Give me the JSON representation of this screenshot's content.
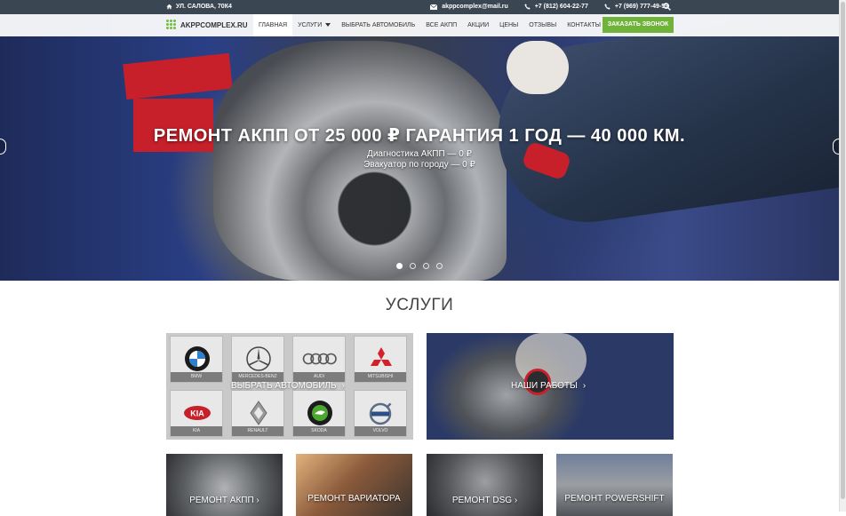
{
  "topbar": {
    "address": "УЛ. САЛОВА, 70К4",
    "email": "akppcomplex@mail.ru",
    "phone1": "+7 (812) 604-22-77",
    "phone2": "+7 (969) 777-49-59"
  },
  "nav": {
    "logo": "AKPPCOMPLEX.RU",
    "items": [
      {
        "label": "ГЛАВНАЯ"
      },
      {
        "label": "УСЛУГИ"
      },
      {
        "label": "ВЫБРАТЬ АВТОМОБИЛЬ"
      },
      {
        "label": "ВСЕ АКПП"
      },
      {
        "label": "АКЦИИ"
      },
      {
        "label": "ЦЕНЫ"
      },
      {
        "label": "ОТЗЫВЫ"
      },
      {
        "label": "КОНТАКТЫ"
      }
    ],
    "call_button": "ЗАКАЗАТЬ ЗВОНОК"
  },
  "hero": {
    "title": "РЕМОНТ АКПП ОТ 25 000 ₽ ГАРАНТИЯ 1 ГОД — 40 000 КМ.",
    "line1": "Диагностика АКПП — 0 ₽",
    "line2": "Эвакуатор по городу — 0 ₽"
  },
  "services": {
    "title": "УСЛУГИ",
    "brands": [
      {
        "name": "BMW"
      },
      {
        "name": "MERCEDES-BENZ"
      },
      {
        "name": "AUDI"
      },
      {
        "name": "MITSUBISHI"
      },
      {
        "name": "KIA"
      },
      {
        "name": "RENAULT"
      },
      {
        "name": "SKODA"
      },
      {
        "name": "VOLVO"
      }
    ],
    "choose_car": "ВЫБРАТЬ АВТОМОБИЛЬ",
    "our_works": "НАШИ РАБОТЫ",
    "tiles": [
      {
        "label": "РЕМОНТ АКПП"
      },
      {
        "label": "РЕМОНТ ВАРИАТОРА"
      },
      {
        "label": "РЕМОНТ DSG"
      },
      {
        "label": "РЕМОНТ POWERSHIFT"
      }
    ]
  },
  "colors": {
    "accent": "#6fb33a",
    "topbar": "#3a4652"
  }
}
